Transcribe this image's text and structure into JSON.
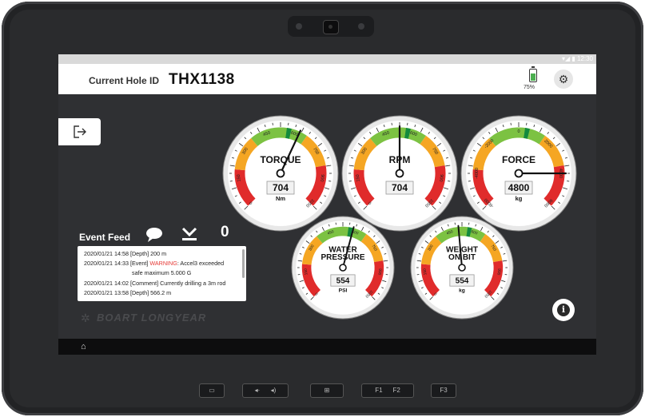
{
  "status_bar": {
    "time": "12:30"
  },
  "header": {
    "hole_label": "Current Hole ID",
    "hole_id": "THX1138",
    "battery_pct": "75%",
    "battery_level": 0.75
  },
  "gauges": [
    {
      "title": "TORQUE",
      "value": "704",
      "unit": "Nm",
      "ticks": [
        "0",
        "150",
        "300",
        "450",
        "600",
        "750",
        "900",
        "1050"
      ]
    },
    {
      "title": "RPM",
      "value": "704",
      "unit": "",
      "ticks": [
        "0",
        "150",
        "300",
        "450",
        "600",
        "750",
        "900",
        "1050"
      ]
    },
    {
      "title": "FORCE",
      "value": "4800",
      "unit": "kg",
      "ticks": [
        "-6000",
        "-4000",
        "-2000",
        "0",
        "2000",
        "4000",
        "6000"
      ]
    },
    {
      "title_line1": "WATER",
      "title_line2": "PRESSURE",
      "value": "554",
      "unit": "PSI",
      "ticks": [
        "0",
        "150",
        "300",
        "450",
        "600",
        "750",
        "900",
        "1050"
      ]
    },
    {
      "title_line1": "WEIGHT",
      "title_line2": "ON BIT",
      "value": "554",
      "unit": "kg",
      "ticks": [
        "0",
        "150",
        "300",
        "450",
        "600",
        "750",
        "900",
        "1050"
      ]
    }
  ],
  "event_feed": {
    "title": "Event Feed",
    "count": "0",
    "rows": [
      {
        "text": "2020/01/21  14:58  [Depth] 200 m"
      },
      {
        "pre": "2020/01/21  14:33  [Event] ",
        "warn": "WARNING",
        "post": ": Accel3 exceeded"
      },
      {
        "text": "safe maximum 5.000 G"
      },
      {
        "text": "2020/01/21  14:02  [Comment] Currently drilling a 3m rod"
      },
      {
        "text": "2020/01/21  13:58  [Depth] 566.2 m"
      }
    ]
  },
  "brand": "BOART LONGYEAR",
  "hardware_buttons": {
    "f1": "F1",
    "f2": "F2",
    "f3": "F3"
  },
  "colors": {
    "red": "#e02b2b",
    "orange": "#f5a623",
    "green": "#7cc242",
    "dark_green": "#138a3e"
  }
}
